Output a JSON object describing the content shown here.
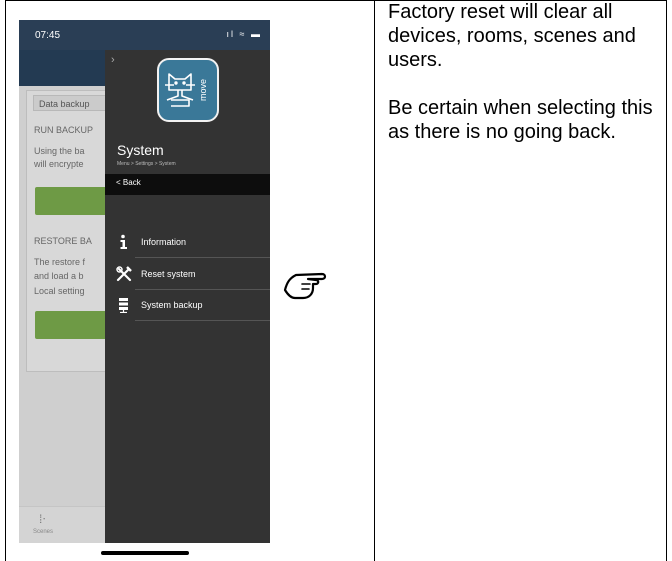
{
  "phone": {
    "time": "07:45",
    "status_icons": "ıl ≈ ▬",
    "card": {
      "header": "Data backup",
      "backup_heading": "RUN BACKUP",
      "backup_desc_1": "Using the ba",
      "backup_desc_2": "will encrypte",
      "restore_heading": "RESTORE BA",
      "restore_desc_1": "The restore f",
      "restore_desc_2": "and load a b",
      "restore_desc_3": "Local setting"
    },
    "tab": {
      "label": "Scenes"
    }
  },
  "drawer": {
    "chevron": "›",
    "logo_text": "move",
    "title": "System",
    "breadcrumb": "Menu > Settings > System",
    "back_label": "Back",
    "items": [
      {
        "label": "Information",
        "icon": "info-icon"
      },
      {
        "label": "Reset system",
        "icon": "tools-icon"
      },
      {
        "label": "System backup",
        "icon": "server-icon"
      }
    ]
  },
  "note": {
    "paragraph_1": "Factory reset will clear all devices, rooms, scenes and users.",
    "paragraph_2": "Be certain when selecting this as there is no going back."
  },
  "colors": {
    "drawer_bg": "#333333",
    "header_blue": "#233a52",
    "accent_green": "#6e9a45",
    "logo_blue": "#3a7898"
  }
}
